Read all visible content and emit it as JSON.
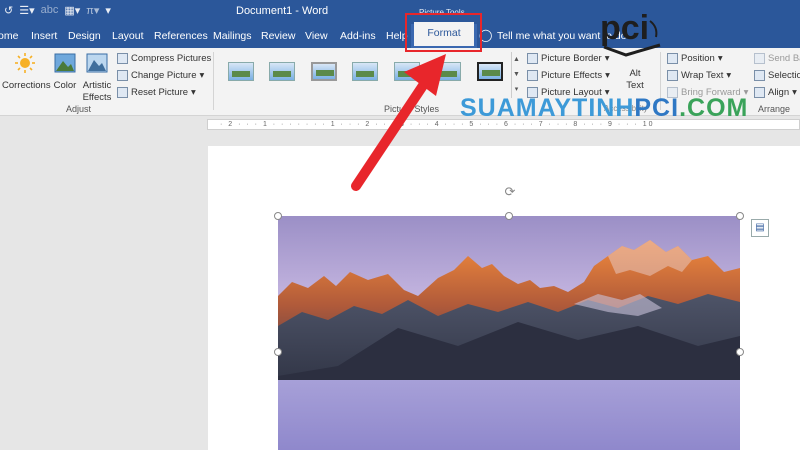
{
  "title_bar": {
    "qat_icons": [
      "undo-icon",
      "bullets-icon",
      "abc-icon",
      "table-icon",
      "pi-icon",
      "customize-icon"
    ],
    "document_title": "Document1  -  Word",
    "context_label": "Picture Tools"
  },
  "tabs": [
    {
      "label": "ome"
    },
    {
      "label": "Insert"
    },
    {
      "label": "Design"
    },
    {
      "label": "Layout"
    },
    {
      "label": "References"
    },
    {
      "label": "Mailings"
    },
    {
      "label": "Review"
    },
    {
      "label": "View"
    },
    {
      "label": "Add-ins"
    },
    {
      "label": "Help"
    }
  ],
  "active_tab": "Format",
  "tell_me": "Tell me what you want to do",
  "adjust": {
    "corrections": "Corrections",
    "color": "Color",
    "artistic_1": "Artistic",
    "artistic_2": "Effects",
    "compress": "Compress Pictures",
    "change": "Change Picture",
    "reset": "Reset Picture",
    "group_label": "Adjust"
  },
  "picture_styles": {
    "group_label": "Picture Styles",
    "thumb_count": 7
  },
  "style_options": {
    "border": "Picture Border",
    "effects": "Picture Effects",
    "layout": "Picture Layout"
  },
  "accessibility": {
    "alt_1": "Alt",
    "alt_2": "Text",
    "group_label": "Accessibility"
  },
  "arrange": {
    "position": "Position",
    "wrap": "Wrap Text",
    "bring": "Bring Forward",
    "send": "Send Ba",
    "selection": "Selectio",
    "align": "Align",
    "group_label": "Arrange"
  },
  "ruler": {
    "marks": "· 2 · · · 1 · · · · · · · 1 · · · 2 · · · 3 · · · 4 · · · 5 · · · 6 · · · 7 · · · 8 · · · 9 · · · 10"
  },
  "watermark": {
    "part1": "SUAMAYTINH",
    "part2": "PCI",
    "part3": ".COM",
    "logo_text": "pci"
  },
  "colors": {
    "word_blue": "#2b579a",
    "highlight_red": "#e8262b",
    "arrow_red": "#e8262b"
  }
}
